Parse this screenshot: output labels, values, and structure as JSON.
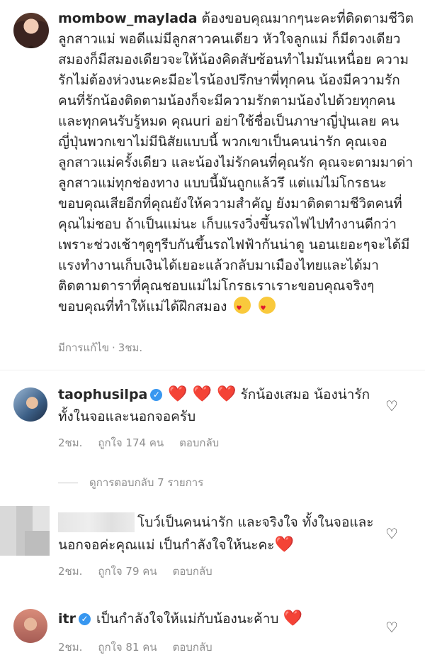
{
  "post": {
    "username": "mombow_maylada",
    "caption": "ต้องขอบคุณมากๆนะคะที่ติดตามชีวิตลูกสาวแม่ พอดีแม่มีลูกสาวคนเดียว หัวใจลูกแม่ ก็มีดวงเดียว สมองก็มีสมองเดียวจะให้น้องคิดสับซ้อนทำไมมันเหนื่อย ความรักไม่ต้องห่วงนะคะมีอะไรน้องปรึกษาพี่ทุกคน น้องมีความรัก คนที่รักน้องติดตามน้องก็จะมีความรักตามน้องไปด้วยทุกคนและทุกคนรับรู้หมด คุณuri อย่าใช้ชื่อเป็นภาษาญี่ปุ่นเลย คนญี่ปุ่นพวกเขาไม่มีนิสัยแบบนี้ พวกเขาเป็นคนน่ารัก คุณเจอลูกสาวแม่ครั้งเดียว และน้องไม่รักคนที่คุณรัก คุณจะตามมาด่าลูกสาวแม่ทุกช่องทาง แบบนี้มันถูกแล้วรึ แต่แม่ไม่โกรธนะ ขอบคุณเสียอีกที่คุณยังให้ความสำคัญ ยังมาติดตามชีวิตคนที่คุณไม่ชอบ ถ้าเป็นแม่นะ เก็บแรงวิ่งขึ้นรถไฟไปทำงานดีกว่า เพราะช่วงเช้าๆดูๆรีบกันขึ้นรถไฟฟ้ากันน่าดู นอนเยอะๆจะได้มีแรงทำงานเก็บเงินได้เยอะแล้วกลับมาเมืองไทยและได้มาติดตามดาราที่คุณชอบแม่ไม่โกรธเราเราะขอบคุณจริงๆ ขอบคุณที่ทำให้แม่ได้ฝึกสมอง",
    "edited_label": "มีการแก้ไข",
    "time": "3ชม."
  },
  "comments": [
    {
      "username": "taophusilpa",
      "hearts": "❤️ ❤️ ❤️",
      "text": "รักน้องเสมอ น้องน่ารักทั้งในจอและนอกจอครับ",
      "time": "2ชม.",
      "likes": "ถูกใจ 174 คน",
      "reply": "ตอบกลับ"
    },
    {
      "username": "",
      "text": "โบว์เป็นคนน่ารัก และจริงใจ ทั้งในจอและนอกจอค่ะคุณแม่ เป็นกำลังใจให้นะคะ",
      "hearts": "❤️",
      "time": "2ชม.",
      "likes": "ถูกใจ 79 คน",
      "reply": "ตอบกลับ"
    },
    {
      "username": "itr",
      "text": "เป็นกำลังใจให้แม่กับน้องนะค้าบ",
      "hearts": "❤️",
      "time": "2ชม.",
      "likes": "ถูกใจ 81 คน",
      "reply": "ตอบกลับ"
    }
  ],
  "view_replies": "ดูการตอบกลับ 7 รายการ",
  "icons": {
    "like": "heart-outline-icon",
    "verified": "verified-badge-icon"
  },
  "colors": {
    "verified": "#3897f0",
    "heart": "#e0182e",
    "meta": "#8e8e8e"
  }
}
